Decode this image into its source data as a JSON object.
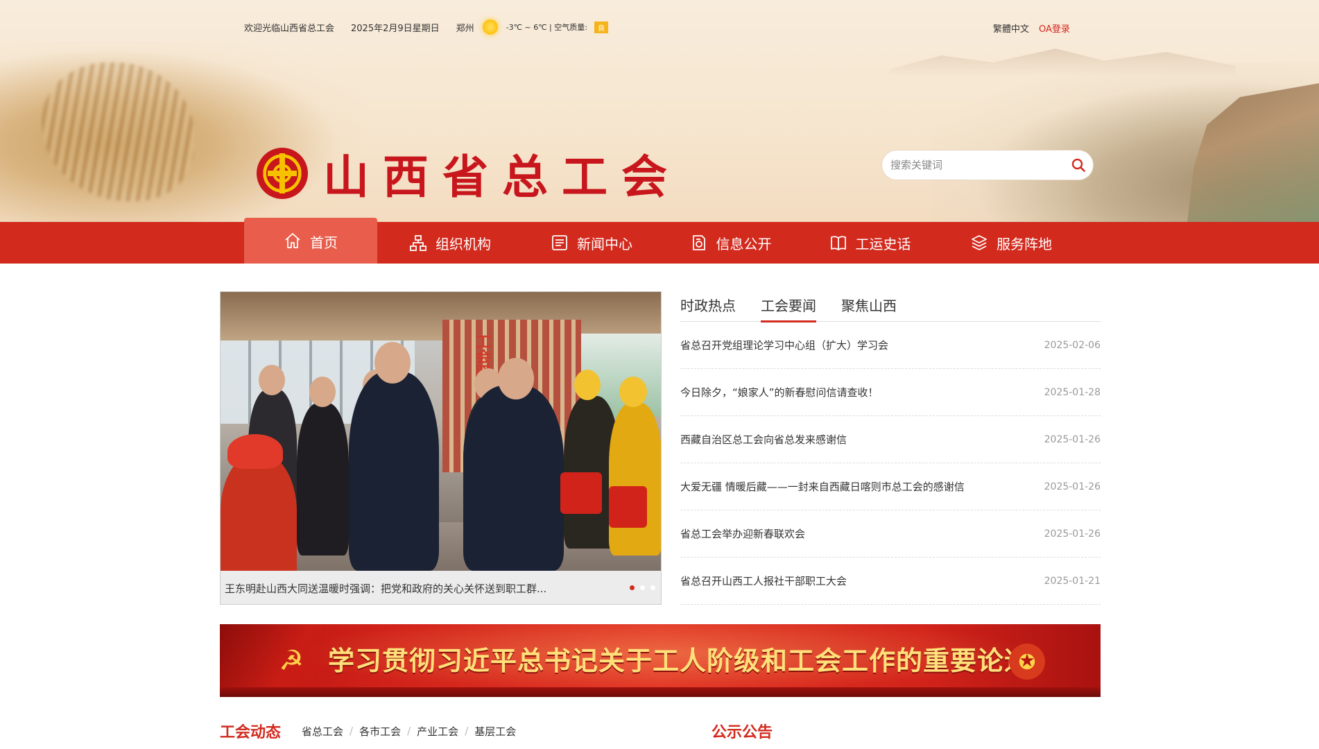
{
  "topbar": {
    "welcome": "欢迎光临山西省总工会",
    "date": "2025年2月9日星期日",
    "city": "郑州",
    "temperature": "-3℃ ~ 6℃ | 空气质量:",
    "air_quality": "良",
    "lang": "繁體中文",
    "oa_login": "OA登录"
  },
  "logo": {
    "title": "山西省总工会"
  },
  "search": {
    "placeholder": "搜索关键词"
  },
  "nav": {
    "items": [
      {
        "label": "首页",
        "icon": "home-icon"
      },
      {
        "label": "组织机构",
        "icon": "org-chart-icon"
      },
      {
        "label": "新闻中心",
        "icon": "newspaper-icon"
      },
      {
        "label": "信息公开",
        "icon": "document-icon"
      },
      {
        "label": "工运史话",
        "icon": "book-icon"
      },
      {
        "label": "服务阵地",
        "icon": "layers-icon"
      }
    ]
  },
  "slider": {
    "caption": "王东明赴山西大同送温暖时强调：把党和政府的关心关怀送到职工群...",
    "wall_text": "工会驿站",
    "active_index": 0
  },
  "news": {
    "tabs": [
      "时政热点",
      "工会要闻",
      "聚焦山西"
    ],
    "active_tab": 1,
    "items": [
      {
        "title": "省总召开党组理论学习中心组（扩大）学习会",
        "date": "2025-02-06"
      },
      {
        "title": "今日除夕，“娘家人”的新春慰问信请查收！",
        "date": "2025-01-28"
      },
      {
        "title": "西藏自治区总工会向省总发来感谢信",
        "date": "2025-01-26"
      },
      {
        "title": "大爱无疆 情暖后藏——一封来自西藏日喀则市总工会的感谢信",
        "date": "2025-01-26"
      },
      {
        "title": "省总工会举办迎新春联欢会",
        "date": "2025-01-26"
      },
      {
        "title": "省总召开山西工人报社干部职工大会",
        "date": "2025-01-21"
      }
    ]
  },
  "banner": {
    "title": "学习贯彻习近平总书记关于工人阶级和工会工作的重要论述"
  },
  "section_left": {
    "title": "工会动态",
    "tabs": [
      "省总工会",
      "各市工会",
      "产业工会",
      "基层工会"
    ]
  },
  "section_right": {
    "title": "公示公告"
  },
  "colors": {
    "primary_red": "#d32a1e",
    "nav_active": "#e85d4b",
    "gold": "#f7c100"
  }
}
